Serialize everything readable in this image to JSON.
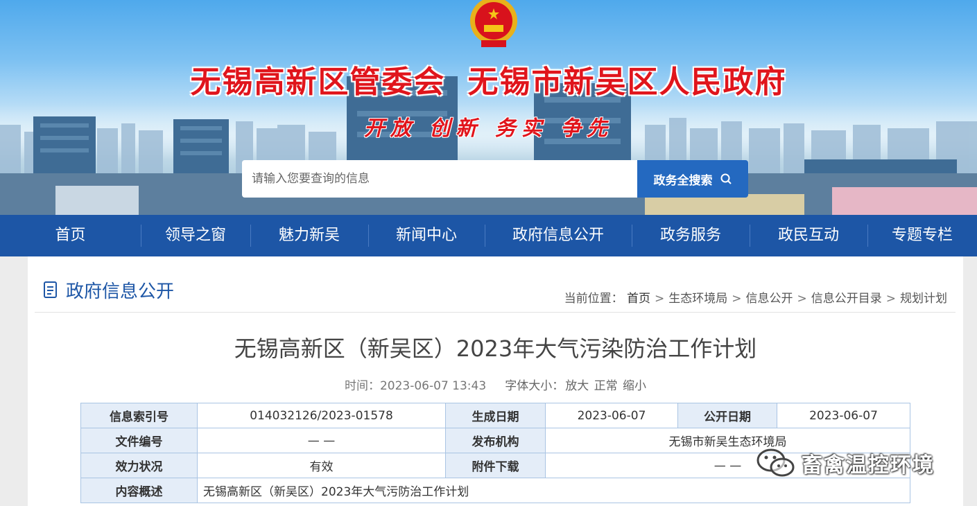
{
  "header": {
    "title_left": "无锡高新区管委会",
    "title_right": "无锡市新吴区人民政府",
    "slogan": "开放 创新 务实 争先",
    "search": {
      "placeholder": "请输入您要查询的信息",
      "button_label": "政务全搜索"
    }
  },
  "nav": [
    "首页",
    "领导之窗",
    "魅力新吴",
    "新闻中心",
    "政府信息公开",
    "政务服务",
    "政民互动",
    "专题专栏"
  ],
  "section": {
    "title": "政府信息公开",
    "breadcrumb_label": "当前位置：",
    "breadcrumb": [
      "首页",
      "生态环境局",
      "信息公开",
      "信息公开目录",
      "规划计划"
    ]
  },
  "article": {
    "title": "无锡高新区（新吴区）2023年大气污染防治工作计划",
    "time_label": "时间：",
    "time": "2023-06-07 13:43",
    "font_size_label": "字体大小：",
    "font_options": [
      "放大",
      "正常",
      "缩小"
    ]
  },
  "info_table": {
    "index_label": "信息索引号",
    "index": "014032126/2023-01578",
    "created_label": "生成日期",
    "created": "2023-06-07",
    "public_label": "公开日期",
    "public": "2023-06-07",
    "doc_no_label": "文件编号",
    "doc_no": "— —",
    "publisher_label": "发布机构",
    "publisher": "无锡市新吴生态环境局",
    "status_label": "效力状况",
    "status": "有效",
    "attach_label": "附件下载",
    "attach": "— —",
    "summary_label": "内容概述",
    "summary": "无锡高新区（新吴区）2023年大气污防治工作计划"
  },
  "watermark": {
    "text": "畜禽温控环境"
  }
}
